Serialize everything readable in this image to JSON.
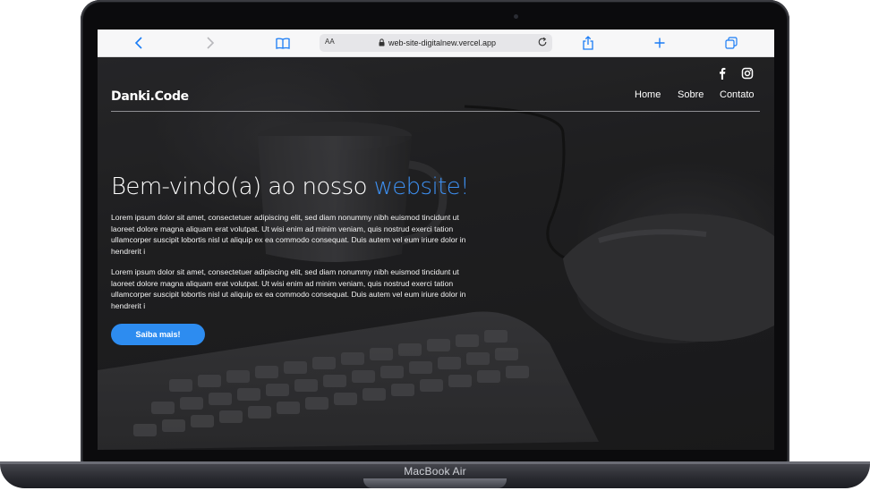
{
  "device": {
    "label": "MacBook Air"
  },
  "browser": {
    "aa_label": "AA",
    "url": "web-site-digitalnew.vercel.app",
    "icons": [
      "back-icon",
      "forward-icon",
      "bookmarks-icon",
      "lock-icon",
      "reload-icon",
      "share-icon",
      "new-tab-icon",
      "tabs-icon"
    ]
  },
  "site": {
    "brand": "Danki.Code",
    "social": [
      "facebook-icon",
      "instagram-icon"
    ],
    "nav": [
      "Home",
      "Sobre",
      "Contato"
    ],
    "hero": {
      "title_main": "Bem-vindo(a) ao nosso ",
      "title_accent": "website!",
      "paragraphs": [
        "Lorem ipsum dolor sit amet, consectetuer adipiscing elit, sed diam nonummy nibh euismod tincidunt ut laoreet dolore magna aliquam erat volutpat. Ut wisi enim ad minim veniam, quis nostrud exerci tation ullamcorper suscipit lobortis nisl ut aliquip ex ea commodo consequat. Duis autem vel eum iriure dolor in hendrerit i",
        "Lorem ipsum dolor sit amet, consectetuer adipiscing elit, sed diam nonummy nibh euismod tincidunt ut laoreet dolore magna aliquam erat volutpat. Ut wisi enim ad minim veniam, quis nostrud exerci tation ullamcorper suscipit lobortis nisl ut aliquip ex ea commodo consequat. Duis autem vel eum iriure dolor in hendrerit i"
      ],
      "cta_label": "Saiba mais!"
    },
    "colors": {
      "accent": "#3d8ff0",
      "button": "#2d8cf0"
    }
  }
}
